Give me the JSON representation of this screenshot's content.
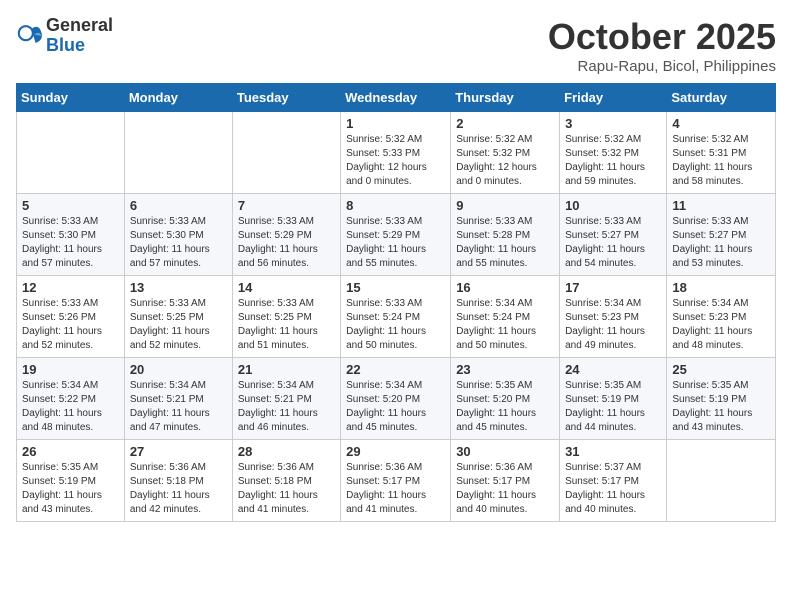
{
  "header": {
    "logo_general": "General",
    "logo_blue": "Blue",
    "month_title": "October 2025",
    "location": "Rapu-Rapu, Bicol, Philippines"
  },
  "weekdays": [
    "Sunday",
    "Monday",
    "Tuesday",
    "Wednesday",
    "Thursday",
    "Friday",
    "Saturday"
  ],
  "weeks": [
    [
      {
        "day": "",
        "info": ""
      },
      {
        "day": "",
        "info": ""
      },
      {
        "day": "",
        "info": ""
      },
      {
        "day": "1",
        "info": "Sunrise: 5:32 AM\nSunset: 5:33 PM\nDaylight: 12 hours\nand 0 minutes."
      },
      {
        "day": "2",
        "info": "Sunrise: 5:32 AM\nSunset: 5:32 PM\nDaylight: 12 hours\nand 0 minutes."
      },
      {
        "day": "3",
        "info": "Sunrise: 5:32 AM\nSunset: 5:32 PM\nDaylight: 11 hours\nand 59 minutes."
      },
      {
        "day": "4",
        "info": "Sunrise: 5:32 AM\nSunset: 5:31 PM\nDaylight: 11 hours\nand 58 minutes."
      }
    ],
    [
      {
        "day": "5",
        "info": "Sunrise: 5:33 AM\nSunset: 5:30 PM\nDaylight: 11 hours\nand 57 minutes."
      },
      {
        "day": "6",
        "info": "Sunrise: 5:33 AM\nSunset: 5:30 PM\nDaylight: 11 hours\nand 57 minutes."
      },
      {
        "day": "7",
        "info": "Sunrise: 5:33 AM\nSunset: 5:29 PM\nDaylight: 11 hours\nand 56 minutes."
      },
      {
        "day": "8",
        "info": "Sunrise: 5:33 AM\nSunset: 5:29 PM\nDaylight: 11 hours\nand 55 minutes."
      },
      {
        "day": "9",
        "info": "Sunrise: 5:33 AM\nSunset: 5:28 PM\nDaylight: 11 hours\nand 55 minutes."
      },
      {
        "day": "10",
        "info": "Sunrise: 5:33 AM\nSunset: 5:27 PM\nDaylight: 11 hours\nand 54 minutes."
      },
      {
        "day": "11",
        "info": "Sunrise: 5:33 AM\nSunset: 5:27 PM\nDaylight: 11 hours\nand 53 minutes."
      }
    ],
    [
      {
        "day": "12",
        "info": "Sunrise: 5:33 AM\nSunset: 5:26 PM\nDaylight: 11 hours\nand 52 minutes."
      },
      {
        "day": "13",
        "info": "Sunrise: 5:33 AM\nSunset: 5:25 PM\nDaylight: 11 hours\nand 52 minutes."
      },
      {
        "day": "14",
        "info": "Sunrise: 5:33 AM\nSunset: 5:25 PM\nDaylight: 11 hours\nand 51 minutes."
      },
      {
        "day": "15",
        "info": "Sunrise: 5:33 AM\nSunset: 5:24 PM\nDaylight: 11 hours\nand 50 minutes."
      },
      {
        "day": "16",
        "info": "Sunrise: 5:34 AM\nSunset: 5:24 PM\nDaylight: 11 hours\nand 50 minutes."
      },
      {
        "day": "17",
        "info": "Sunrise: 5:34 AM\nSunset: 5:23 PM\nDaylight: 11 hours\nand 49 minutes."
      },
      {
        "day": "18",
        "info": "Sunrise: 5:34 AM\nSunset: 5:23 PM\nDaylight: 11 hours\nand 48 minutes."
      }
    ],
    [
      {
        "day": "19",
        "info": "Sunrise: 5:34 AM\nSunset: 5:22 PM\nDaylight: 11 hours\nand 48 minutes."
      },
      {
        "day": "20",
        "info": "Sunrise: 5:34 AM\nSunset: 5:21 PM\nDaylight: 11 hours\nand 47 minutes."
      },
      {
        "day": "21",
        "info": "Sunrise: 5:34 AM\nSunset: 5:21 PM\nDaylight: 11 hours\nand 46 minutes."
      },
      {
        "day": "22",
        "info": "Sunrise: 5:34 AM\nSunset: 5:20 PM\nDaylight: 11 hours\nand 45 minutes."
      },
      {
        "day": "23",
        "info": "Sunrise: 5:35 AM\nSunset: 5:20 PM\nDaylight: 11 hours\nand 45 minutes."
      },
      {
        "day": "24",
        "info": "Sunrise: 5:35 AM\nSunset: 5:19 PM\nDaylight: 11 hours\nand 44 minutes."
      },
      {
        "day": "25",
        "info": "Sunrise: 5:35 AM\nSunset: 5:19 PM\nDaylight: 11 hours\nand 43 minutes."
      }
    ],
    [
      {
        "day": "26",
        "info": "Sunrise: 5:35 AM\nSunset: 5:19 PM\nDaylight: 11 hours\nand 43 minutes."
      },
      {
        "day": "27",
        "info": "Sunrise: 5:36 AM\nSunset: 5:18 PM\nDaylight: 11 hours\nand 42 minutes."
      },
      {
        "day": "28",
        "info": "Sunrise: 5:36 AM\nSunset: 5:18 PM\nDaylight: 11 hours\nand 41 minutes."
      },
      {
        "day": "29",
        "info": "Sunrise: 5:36 AM\nSunset: 5:17 PM\nDaylight: 11 hours\nand 41 minutes."
      },
      {
        "day": "30",
        "info": "Sunrise: 5:36 AM\nSunset: 5:17 PM\nDaylight: 11 hours\nand 40 minutes."
      },
      {
        "day": "31",
        "info": "Sunrise: 5:37 AM\nSunset: 5:17 PM\nDaylight: 11 hours\nand 40 minutes."
      },
      {
        "day": "",
        "info": ""
      }
    ]
  ]
}
